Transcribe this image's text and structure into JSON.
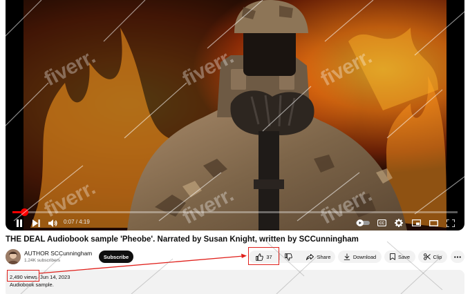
{
  "player": {
    "current_time": "0:07",
    "duration": "4:19",
    "progress_fraction": 0.027,
    "controls": [
      "pause-icon",
      "next-icon",
      "volume-icon",
      "autoplay-toggle",
      "subtitles-icon",
      "settings-icon",
      "miniplayer-icon",
      "theater-icon",
      "fullscreen-icon"
    ],
    "accent_color": "#ff0000"
  },
  "video": {
    "title": "THE DEAL Audiobook sample 'Pheobe'. Narrated by Susan Knight, written by SCCunningham"
  },
  "channel": {
    "name": "AUTHOR SCCunningham",
    "subscribers": "1.24K subscribers",
    "subscribe_label": "Subscribe"
  },
  "actions": {
    "like_count": "37",
    "share_label": "Share",
    "download_label": "Download",
    "save_label": "Save",
    "clip_label": "Clip"
  },
  "description": {
    "views": "2,490 views",
    "date": "Jun 14, 2023",
    "text": "Audiobook sample."
  },
  "watermark": {
    "text": "fiverr",
    "suffix": "."
  },
  "annotation": {
    "box_color": "#e0201b"
  }
}
